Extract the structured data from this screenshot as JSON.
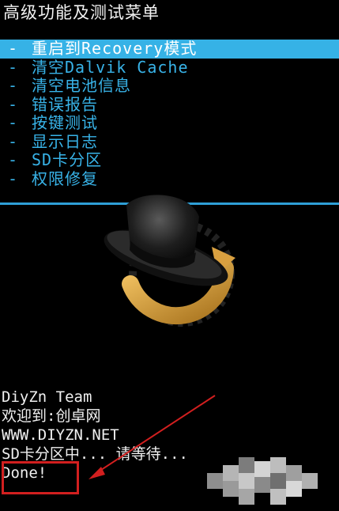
{
  "header": {
    "title": "高级功能及测试菜单"
  },
  "menu": {
    "items": [
      {
        "prefix": "-",
        "label": "重启到Recovery模式",
        "selected": true
      },
      {
        "prefix": "-",
        "label": "清空Dalvik Cache",
        "selected": false
      },
      {
        "prefix": "-",
        "label": "清空电池信息",
        "selected": false
      },
      {
        "prefix": "-",
        "label": "错误报告",
        "selected": false
      },
      {
        "prefix": "-",
        "label": "按键测试",
        "selected": false
      },
      {
        "prefix": "-",
        "label": "显示日志",
        "selected": false
      },
      {
        "prefix": "-",
        "label": "SD卡分区",
        "selected": false
      },
      {
        "prefix": "-",
        "label": "权限修复",
        "selected": false
      }
    ]
  },
  "logo": {
    "icon": "clockworkmod-hat-icon"
  },
  "log": {
    "lines": [
      "DiyZn Team",
      "欢迎到:创卓网",
      "WWW.DIYZN.NET",
      "SD卡分区中... 请等待...",
      "Done!"
    ]
  },
  "colors": {
    "background": "#000000",
    "accent": "#36b2e6",
    "menu_text": "#38b3e8",
    "highlight_box": "#d21f1f"
  }
}
